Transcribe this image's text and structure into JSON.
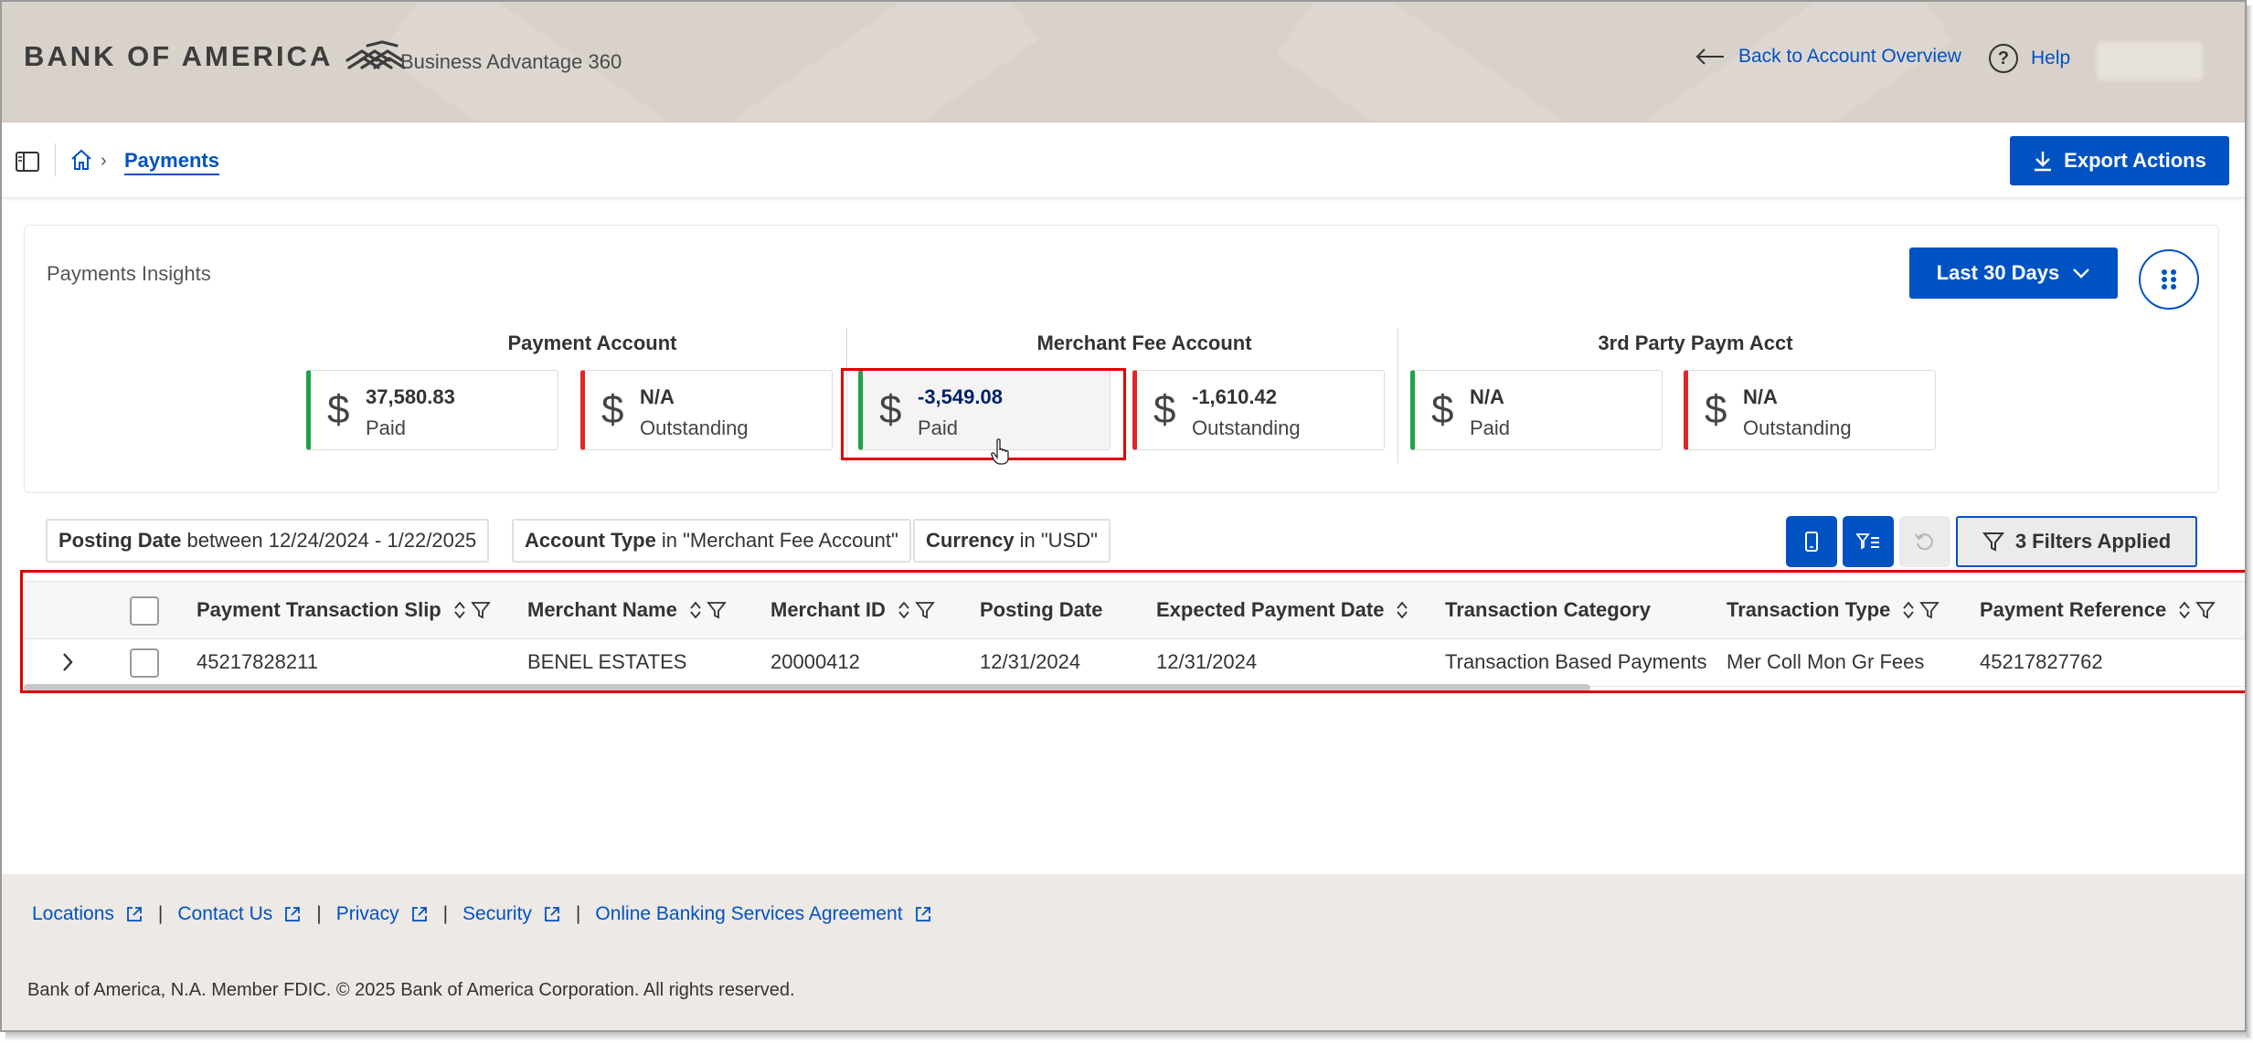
{
  "header": {
    "brand": "BANK OF AMERICA",
    "product": "Business Advantage 360",
    "back_link": "Back to Account Overview",
    "help": "Help",
    "help_glyph": "?"
  },
  "breadcrumb": {
    "current": "Payments"
  },
  "toolbar": {
    "export_label": "Export Actions"
  },
  "insights": {
    "title": "Payments Insights",
    "period": "Last 30 Days",
    "groups": [
      {
        "title": "Payment Account",
        "cards": [
          {
            "amount": "37,580.83",
            "label": "Paid",
            "status_color": "#1fa24a"
          },
          {
            "amount": "N/A",
            "label": "Outstanding",
            "status_color": "#e2262b"
          }
        ]
      },
      {
        "title": "Merchant Fee Account",
        "cards": [
          {
            "amount": "-3,549.08",
            "label": "Paid",
            "status_color": "#1fa24a"
          },
          {
            "amount": "-1,610.42",
            "label": "Outstanding",
            "status_color": "#e2262b"
          }
        ]
      },
      {
        "title": "3rd Party Paym Acct",
        "cards": [
          {
            "amount": "N/A",
            "label": "Paid",
            "status_color": "#1fa24a"
          },
          {
            "amount": "N/A",
            "label": "Outstanding",
            "status_color": "#e2262b"
          }
        ]
      }
    ],
    "currency_symbol": "$"
  },
  "filters": {
    "chips": [
      {
        "field": "Posting Date",
        "value": "between 12/24/2024 - 1/22/2025"
      },
      {
        "field": "Account Type",
        "value": "in \"Merchant Fee Account\""
      },
      {
        "field": "Currency",
        "value": "in \"USD\""
      }
    ],
    "applied_label": "3 Filters Applied"
  },
  "table": {
    "columns": [
      "Payment Transaction Slip",
      "Merchant Name",
      "Merchant ID",
      "Posting Date",
      "Expected Payment Date",
      "Transaction Category",
      "Transaction Type",
      "Payment Reference"
    ],
    "rows": [
      [
        "45217828211",
        "BENEL ESTATES",
        "20000412",
        "12/31/2024",
        "12/31/2024",
        "Transaction Based Payments",
        "Mer Coll Mon Gr Fees",
        "45217827762"
      ]
    ]
  },
  "footer": {
    "links": [
      "Locations",
      "Contact Us",
      "Privacy",
      "Security",
      "Online Banking Services Agreement"
    ],
    "separator": "|",
    "copyright": "Bank of America, N.A. Member FDIC. © 2025 Bank of America Corporation. All rights reserved."
  },
  "colors": {
    "primary": "#0052c2",
    "header_bg": "#d9d2cb",
    "paid": "#1fa24a",
    "outstanding": "#e2262b",
    "annotation": "#e00000"
  }
}
